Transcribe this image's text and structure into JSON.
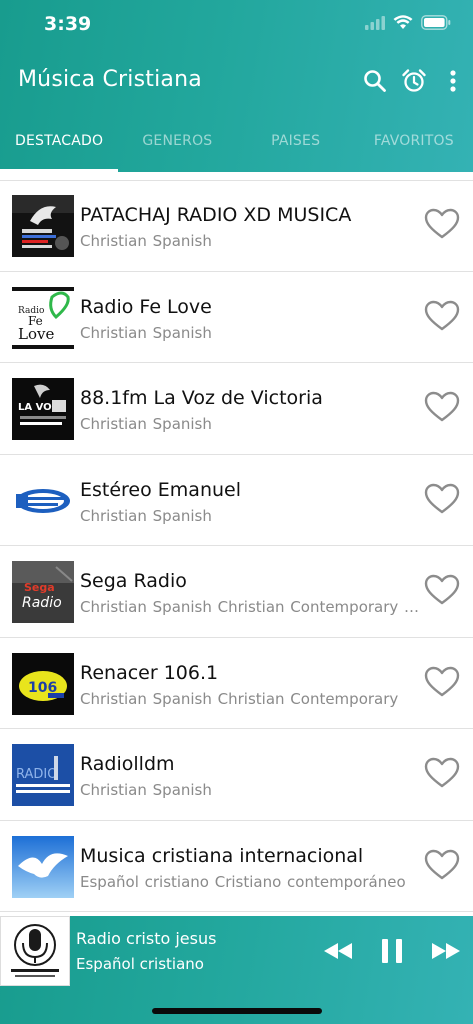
{
  "status_bar": {
    "time": "3:39"
  },
  "app_bar": {
    "title": "Música Cristiana"
  },
  "tabs": [
    {
      "label": "DESTACADO",
      "active": true
    },
    {
      "label": "GENEROS",
      "active": false
    },
    {
      "label": "PAISES",
      "active": false
    },
    {
      "label": "FAVORITOS",
      "active": false
    }
  ],
  "stations": [
    {
      "name": "PATACHAJ RADIO XD MUSICA",
      "genres": "Christian Spanish",
      "logo": "dove-logo"
    },
    {
      "name": "Radio Fe Love",
      "genres": "Christian Spanish",
      "logo": "fe-love-logo"
    },
    {
      "name": "88.1fm La Voz de Victoria",
      "genres": "Christian Spanish",
      "logo": "la-voz-logo"
    },
    {
      "name": "Estéreo Emanuel",
      "genres": "Christian Spanish",
      "logo": "estereo-emanuel-logo"
    },
    {
      "name": "Sega Radio",
      "genres": "Christian Spanish  Christian Contemporary  Christian",
      "logo": "sega-radio-logo"
    },
    {
      "name": "Renacer 106.1",
      "genres": "Christian Spanish  Christian Contemporary",
      "logo": "renacer-logo"
    },
    {
      "name": "Radiolldm",
      "genres": "Christian Spanish",
      "logo": "radiolldm-logo"
    },
    {
      "name": "Musica cristiana internacional",
      "genres": "Español cristiano  Cristiano contemporáneo",
      "logo": "dove-sky-logo"
    }
  ],
  "now_playing": {
    "name": "Radio cristo jesus",
    "genre": "Español cristiano",
    "logo": "microphone-logo"
  },
  "colors": {
    "accent": "#22a79d",
    "accent_light": "#34b2b4",
    "heart": "#8c8c8c"
  }
}
